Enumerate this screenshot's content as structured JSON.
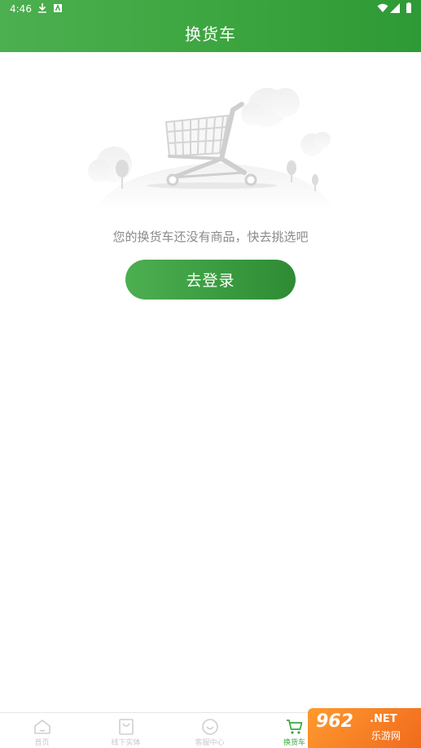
{
  "status_bar": {
    "time": "4:46",
    "left_icons": [
      "download-icon",
      "a-box-icon"
    ],
    "right_icons": [
      "wifi-icon",
      "cellular-icon",
      "battery-icon"
    ]
  },
  "header": {
    "title": "换货车",
    "background_colors": [
      "#4caf50",
      "#2e9a35"
    ]
  },
  "empty_state": {
    "illustration": "empty-cart-illustration",
    "message": "您的换货车还没有商品，快去挑选吧",
    "button_label": "去登录",
    "button_colors": [
      "#4caf50",
      "#2e8b34"
    ]
  },
  "tabbar": {
    "items": [
      {
        "label": "首页",
        "icon": "home-icon",
        "active": false
      },
      {
        "label": "线下实体",
        "icon": "shopping-bag-icon",
        "active": false
      },
      {
        "label": "客服中心",
        "icon": "smile-icon",
        "active": false
      },
      {
        "label": "换货车",
        "icon": "cart-icon",
        "active": true
      }
    ],
    "active_color": "#3da640",
    "inactive_color": "#c8c8c8"
  },
  "watermark": {
    "main": "962",
    "suffix": ".NET",
    "sub": "乐游网"
  }
}
